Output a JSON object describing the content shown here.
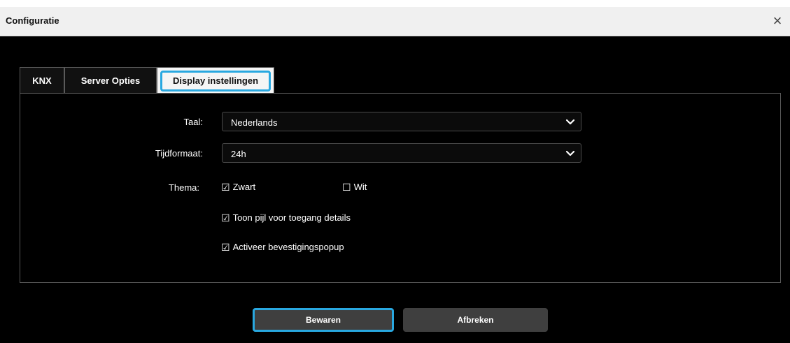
{
  "window": {
    "title": "Configuratie",
    "close_symbol": "×"
  },
  "tabs": [
    {
      "label": "KNX",
      "active": false
    },
    {
      "label": "Server Opties",
      "active": false
    },
    {
      "label": "Display instellingen",
      "active": true
    }
  ],
  "settings": {
    "language": {
      "label": "Taal:",
      "value": "Nederlands"
    },
    "time_format": {
      "label": "Tijdformaat:",
      "value": "24h"
    },
    "theme": {
      "label": "Thema:",
      "options": [
        {
          "label": "Zwart",
          "checked": true
        },
        {
          "label": "Wit",
          "checked": false
        }
      ]
    },
    "show_arrow": {
      "label": "Toon pijl voor toegang details",
      "checked": true
    },
    "confirm_popup": {
      "label": "Activeer bevestigingspopup",
      "checked": true
    }
  },
  "buttons": {
    "save": "Bewaren",
    "cancel": "Afbreken"
  },
  "symbols": {
    "checked": "☑",
    "unchecked": "☐"
  },
  "colors": {
    "accent": "#29a8e0",
    "background": "#000000",
    "button": "#3f3f3f"
  }
}
